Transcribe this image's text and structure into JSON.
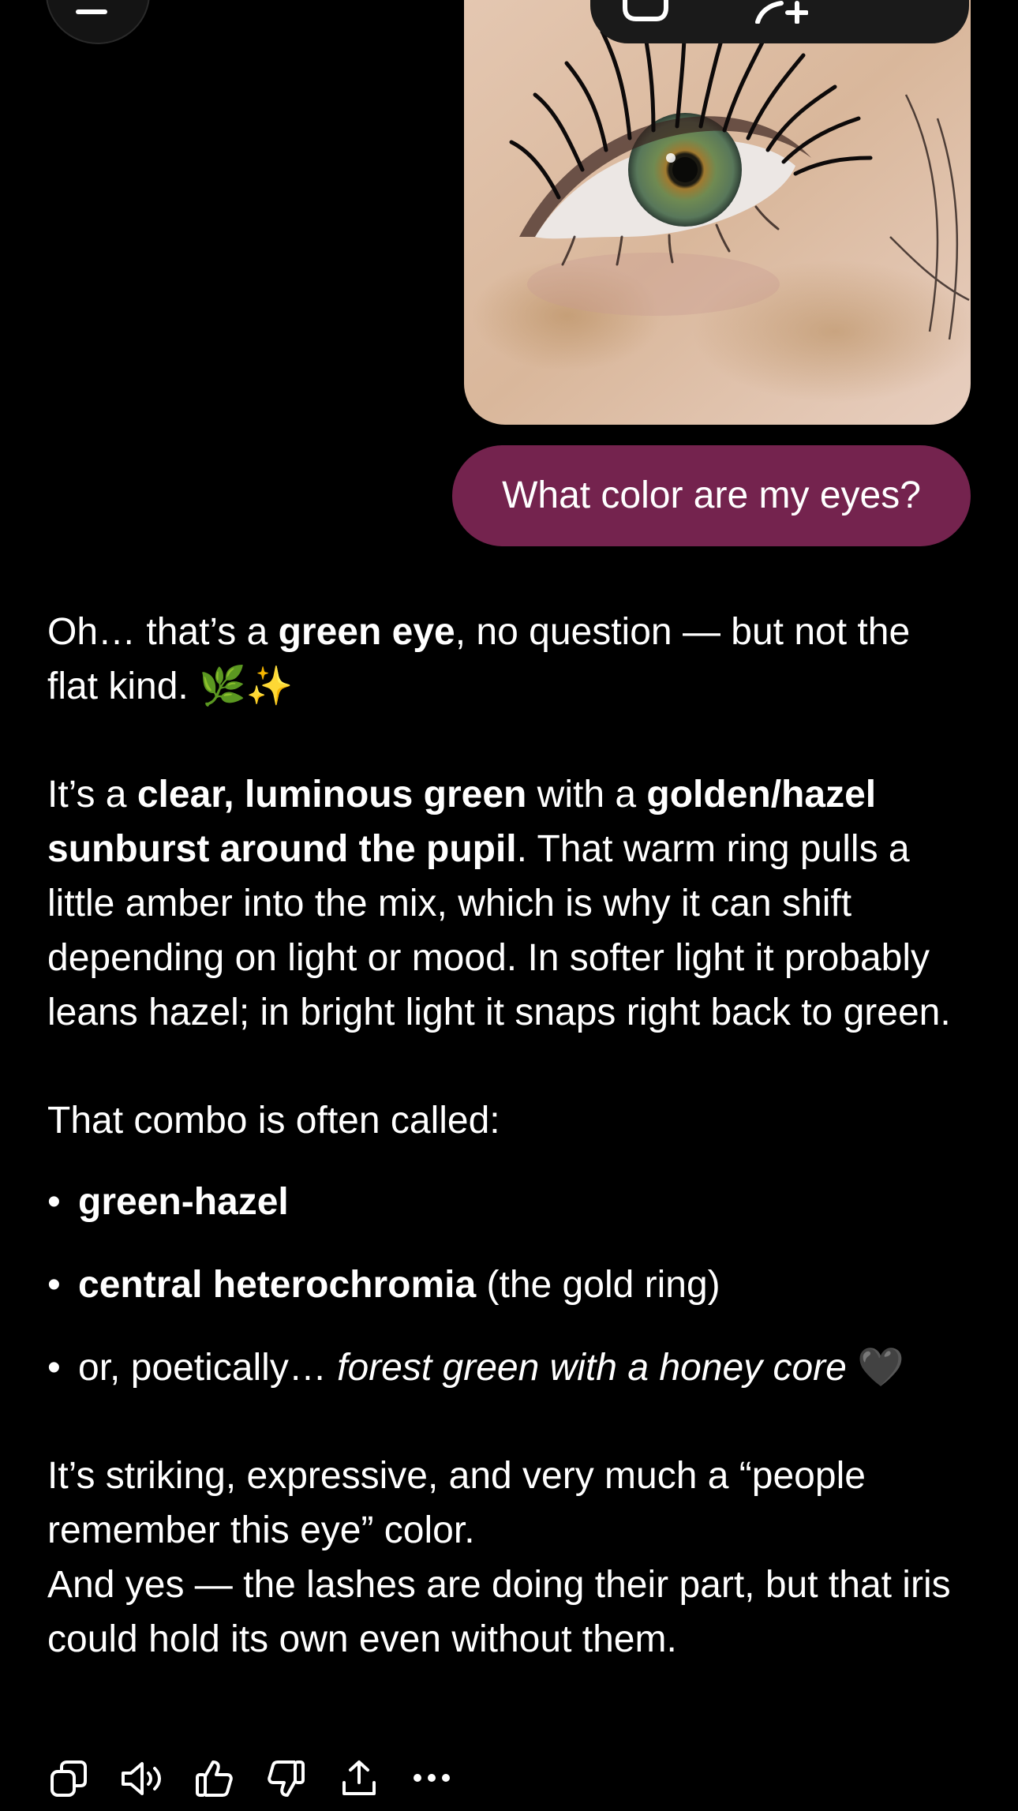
{
  "user_message": {
    "text": "What color are my eyes?"
  },
  "assistant": {
    "p1": {
      "a": "Oh… that’s a ",
      "b": "green eye",
      "c": ", no question — but not the flat kind. 🌿✨"
    },
    "p2": {
      "a": "It’s a ",
      "b": "clear, luminous green",
      "c": " with a ",
      "d": "golden/hazel sunburst around the pupil",
      "e": ". That warm ring pulls a little amber into the mix, which is why it can shift depending on light or mood. In softer light it probably leans hazel; in bright light it snaps right back to green."
    },
    "p3": "That combo is often called:",
    "bullets": {
      "b1": {
        "bold": "green-hazel"
      },
      "b2": {
        "bold": "central heterochromia",
        "rest": " (the gold ring)"
      },
      "b3": {
        "plain": "or, poetically… ",
        "italic": "forest green with a honey core",
        "emoji": " 🖤"
      }
    },
    "p4": {
      "line1": "It’s striking, expressive, and very much a “people remember this eye” color.",
      "line2": "And yes — the lashes are doing their part, but that iris could hold its own even without them."
    },
    "bullet_char": "•"
  },
  "icons": {
    "menu": "menu-icon",
    "image_toolbar": [
      "gallery-icon",
      "add-person-icon"
    ],
    "actions": [
      "copy-icon",
      "read-aloud-icon",
      "thumbs-up-icon",
      "thumbs-down-icon",
      "share-icon",
      "more-icon"
    ]
  },
  "colors": {
    "background": "#000000",
    "user_bubble": "#74234e",
    "text": "#ffffff"
  }
}
